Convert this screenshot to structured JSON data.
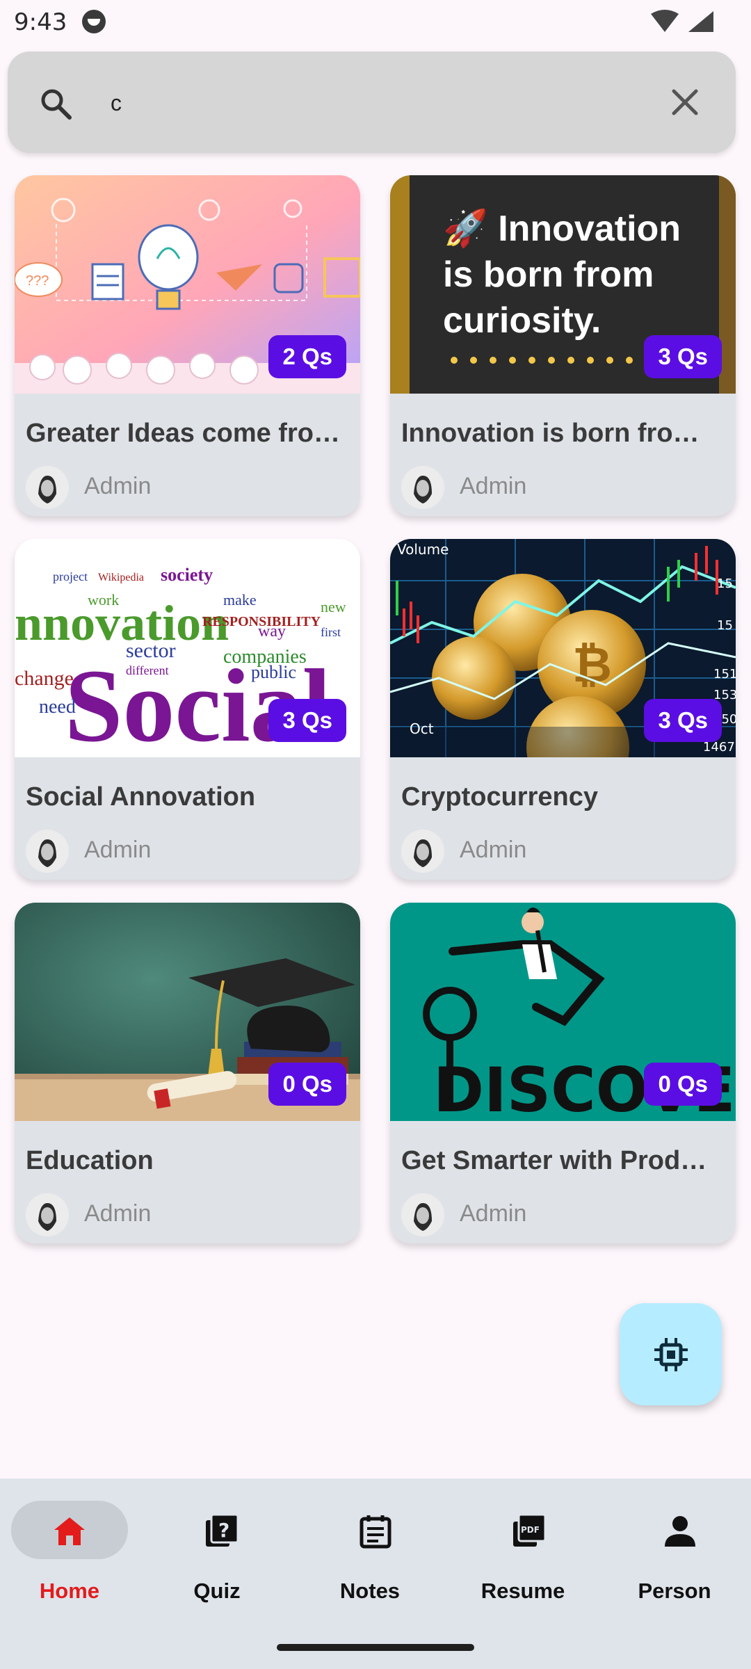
{
  "status_bar": {
    "time": "9:43"
  },
  "search": {
    "value": "c",
    "placeholder": ""
  },
  "cards": [
    {
      "title": "Greater Ideas come fro…",
      "author": "Admin",
      "questions": "2 Qs",
      "thumb_text": "???"
    },
    {
      "title": "Innovation is born fro…",
      "author": "Admin",
      "questions": "3 Qs",
      "thumb_line1": "🚀 Innovation",
      "thumb_line2": "is born from",
      "thumb_line3": "curiosity."
    },
    {
      "title": "Social Annovation",
      "author": "Admin",
      "questions": "3 Qs",
      "thumb_word1": "nnovation",
      "thumb_word2": "Social",
      "thumb_small": [
        "sector",
        "companies",
        "RESPONSIBILITY",
        "public",
        "different",
        "need",
        "change",
        "work",
        "make",
        "way",
        "first",
        "new",
        "society",
        "project",
        "Wikipedia"
      ]
    },
    {
      "title": "Cryptocurrency",
      "author": "Admin",
      "questions": "3 Qs",
      "thumb_text_top": "Volume",
      "thumb_text_bottom": "Oct",
      "thumb_axis": [
        "15",
        "15",
        "151",
        "153",
        "150",
        "1467"
      ]
    },
    {
      "title": "Education",
      "author": "Admin",
      "questions": "0 Qs"
    },
    {
      "title": "Get Smarter with Prod…",
      "author": "Admin",
      "questions": "0 Qs",
      "thumb_word": "DISCOVE"
    }
  ],
  "nav": {
    "items": [
      {
        "label": "Home",
        "icon": "home-icon",
        "active": true
      },
      {
        "label": "Quiz",
        "icon": "quiz-icon",
        "active": false
      },
      {
        "label": "Notes",
        "icon": "notes-icon",
        "active": false
      },
      {
        "label": "Resume",
        "icon": "pdf-icon",
        "active": false
      },
      {
        "label": "Person",
        "icon": "person-icon",
        "active": false
      }
    ]
  },
  "colors": {
    "badge": "#5b0ee3",
    "active_nav": "#e31b1b",
    "fab": "#b5ecff",
    "nav_bg": "#dfe4ea"
  }
}
